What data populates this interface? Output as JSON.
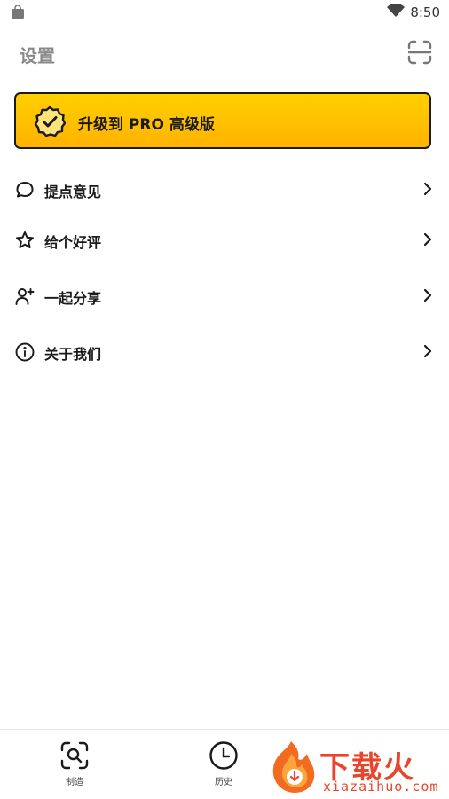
{
  "statusbar": {
    "time": "8:50"
  },
  "header": {
    "title": "设置"
  },
  "pro": {
    "label": "升级到 PRO 高级版"
  },
  "menu": [
    {
      "label": "提点意见",
      "icon": "chat-bubble-icon"
    },
    {
      "label": "给个好评",
      "icon": "star-icon"
    },
    {
      "label": "一起分享",
      "icon": "add-user-icon"
    },
    {
      "label": "关于我们",
      "icon": "info-icon"
    }
  ],
  "nav": [
    {
      "label": "制造",
      "icon": "scan-search-icon"
    },
    {
      "label": "历史",
      "icon": "clock-icon"
    }
  ],
  "watermark": {
    "text": "下载火",
    "sub": "xiazaihuo.com"
  },
  "colors": {
    "pro_yellow": "#ffc400",
    "watermark_red": "#e8462c"
  }
}
